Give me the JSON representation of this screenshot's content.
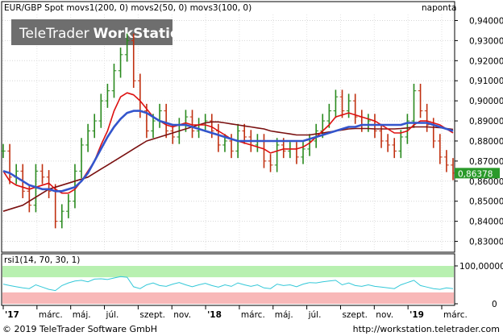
{
  "header": {
    "legend": "EUR/GBP Spot movs1(200, 0) movs2(50, 0) movs3(100, 0)",
    "period": "naponta",
    "watermark_brand": "TeleTrader",
    "watermark_product": "WorkStation"
  },
  "price_axis": {
    "ticks": [
      "0,94000",
      "0,93000",
      "0,92000",
      "0,91000",
      "0,90000",
      "0,89000",
      "0,88000",
      "0,87000",
      "0,86000",
      "0,85000",
      "0,84000",
      "0,83000"
    ],
    "last_value": "0,86378"
  },
  "rsi_panel": {
    "legend": "rsi1(14, 70, 30, 1)",
    "ticks": [
      "100,00000",
      "0"
    ]
  },
  "time_axis": {
    "labels": [
      "'17",
      "márc.",
      "máj.",
      "júl.",
      "szept.",
      "nov.",
      "'18",
      "márc.",
      "máj.",
      "júl.",
      "szept.",
      "nov.",
      "'19",
      "márc."
    ]
  },
  "footer": {
    "copyright": "© 2019 TeleTrader Software GmbH",
    "url": "http://workstation.teletrader.com"
  },
  "colors": {
    "price_up": "#2a8a1e",
    "price_down": "#c03010",
    "ma_200": "#7a1010",
    "ma_50": "#dd1010",
    "ma_100": "#3355cc",
    "rsi_line": "#33c8d8",
    "rsi_overbought_zone": "#b8f0b0",
    "rsi_oversold_zone": "#f8b8b8",
    "last_value_box": "#2a9a2a"
  },
  "chart_data": [
    {
      "type": "line",
      "series": [
        {
          "values": [
            0.875,
            0.862,
            0.865,
            0.855,
            0.848,
            0.865,
            0.862,
            0.855,
            0.84,
            0.845,
            0.85,
            0.865,
            0.878,
            0.885,
            0.89,
            0.9,
            0.905,
            0.915,
            0.923,
            0.93,
            0.91,
            0.895,
            0.885,
            0.89,
            0.895,
            0.885,
            0.882,
            0.888,
            0.892,
            0.885,
            0.888,
            0.89,
            0.885,
            0.878,
            0.88,
            0.875,
            0.885,
            0.882,
            0.878,
            0.88,
            0.87,
            0.868,
            0.878,
            0.875,
            0.876,
            0.872,
            0.876,
            0.88,
            0.885,
            0.89,
            0.895,
            0.902,
            0.895,
            0.9,
            0.892,
            0.888,
            0.89,
            0.885,
            0.88,
            0.878,
            0.875,
            0.882,
            0.89,
            0.905,
            0.895,
            0.888,
            0.88,
            0.872,
            0.868,
            0.864
          ]
        },
        {
          "values": [
            0.845,
            0.846,
            0.847,
            0.848,
            0.85,
            0.852,
            0.854,
            0.856,
            0.857,
            0.858,
            0.859,
            0.86,
            0.861,
            0.862,
            0.864,
            0.866,
            0.868,
            0.87,
            0.872,
            0.874,
            0.876,
            0.878,
            0.88,
            0.881,
            0.882,
            0.883,
            0.884,
            0.885,
            0.886,
            0.887,
            0.888,
            0.889,
            0.8895,
            0.8895,
            0.889,
            0.8885,
            0.888,
            0.8875,
            0.887,
            0.8865,
            0.886,
            0.885,
            0.8845,
            0.884,
            0.8835,
            0.883,
            0.883,
            0.883,
            0.8835,
            0.884,
            0.8845,
            0.885,
            0.8855,
            0.886,
            0.8862,
            0.8862,
            0.8862,
            0.886,
            0.886,
            0.886,
            0.886,
            0.8862,
            0.8865,
            0.887,
            0.887,
            0.887,
            0.8868,
            0.8866,
            0.8862,
            0.8858
          ]
        },
        {
          "values": [
            0.865,
            0.86,
            0.858,
            0.857,
            0.856,
            0.857,
            0.858,
            0.859,
            0.856,
            0.854,
            0.854,
            0.856,
            0.86,
            0.865,
            0.87,
            0.878,
            0.885,
            0.895,
            0.902,
            0.904,
            0.903,
            0.9,
            0.896,
            0.892,
            0.89,
            0.888,
            0.887,
            0.888,
            0.889,
            0.888,
            0.888,
            0.888,
            0.887,
            0.885,
            0.883,
            0.881,
            0.88,
            0.879,
            0.878,
            0.877,
            0.876,
            0.874,
            0.875,
            0.876,
            0.876,
            0.876,
            0.877,
            0.879,
            0.882,
            0.885,
            0.888,
            0.892,
            0.893,
            0.894,
            0.893,
            0.892,
            0.891,
            0.89,
            0.888,
            0.886,
            0.884,
            0.884,
            0.885,
            0.888,
            0.89,
            0.89,
            0.889,
            0.888,
            0.886,
            0.884
          ]
        },
        {
          "values": [
            0.865,
            0.864,
            0.862,
            0.86,
            0.858,
            0.857,
            0.856,
            0.856,
            0.855,
            0.855,
            0.856,
            0.857,
            0.86,
            0.864,
            0.87,
            0.876,
            0.882,
            0.887,
            0.891,
            0.894,
            0.895,
            0.895,
            0.894,
            0.892,
            0.89,
            0.889,
            0.888,
            0.888,
            0.888,
            0.887,
            0.886,
            0.885,
            0.884,
            0.883,
            0.882,
            0.881,
            0.88,
            0.88,
            0.88,
            0.88,
            0.88,
            0.88,
            0.88,
            0.88,
            0.88,
            0.88,
            0.88,
            0.881,
            0.882,
            0.883,
            0.884,
            0.885,
            0.886,
            0.887,
            0.887,
            0.888,
            0.888,
            0.888,
            0.888,
            0.888,
            0.888,
            0.888,
            0.889,
            0.889,
            0.889,
            0.889,
            0.888,
            0.887,
            0.886,
            0.885
          ]
        }
      ],
      "ylim": [
        0.825,
        0.943
      ],
      "grid": true
    },
    {
      "type": "line",
      "series": [
        {
          "values": [
            52,
            48,
            45,
            42,
            40,
            50,
            44,
            38,
            35,
            48,
            55,
            60,
            62,
            58,
            65,
            66,
            64,
            68,
            72,
            70,
            45,
            40,
            50,
            55,
            48,
            46,
            52,
            56,
            50,
            45,
            50,
            54,
            48,
            44,
            50,
            46,
            55,
            50,
            46,
            50,
            42,
            40,
            52,
            48,
            50,
            45,
            52,
            56,
            55,
            58,
            60,
            62,
            50,
            55,
            48,
            46,
            50,
            46,
            44,
            42,
            40,
            50,
            56,
            62,
            48,
            44,
            40,
            38,
            42,
            40
          ]
        }
      ],
      "ylim": [
        0,
        100
      ],
      "annotations": [
        "70",
        "30"
      ]
    }
  ]
}
